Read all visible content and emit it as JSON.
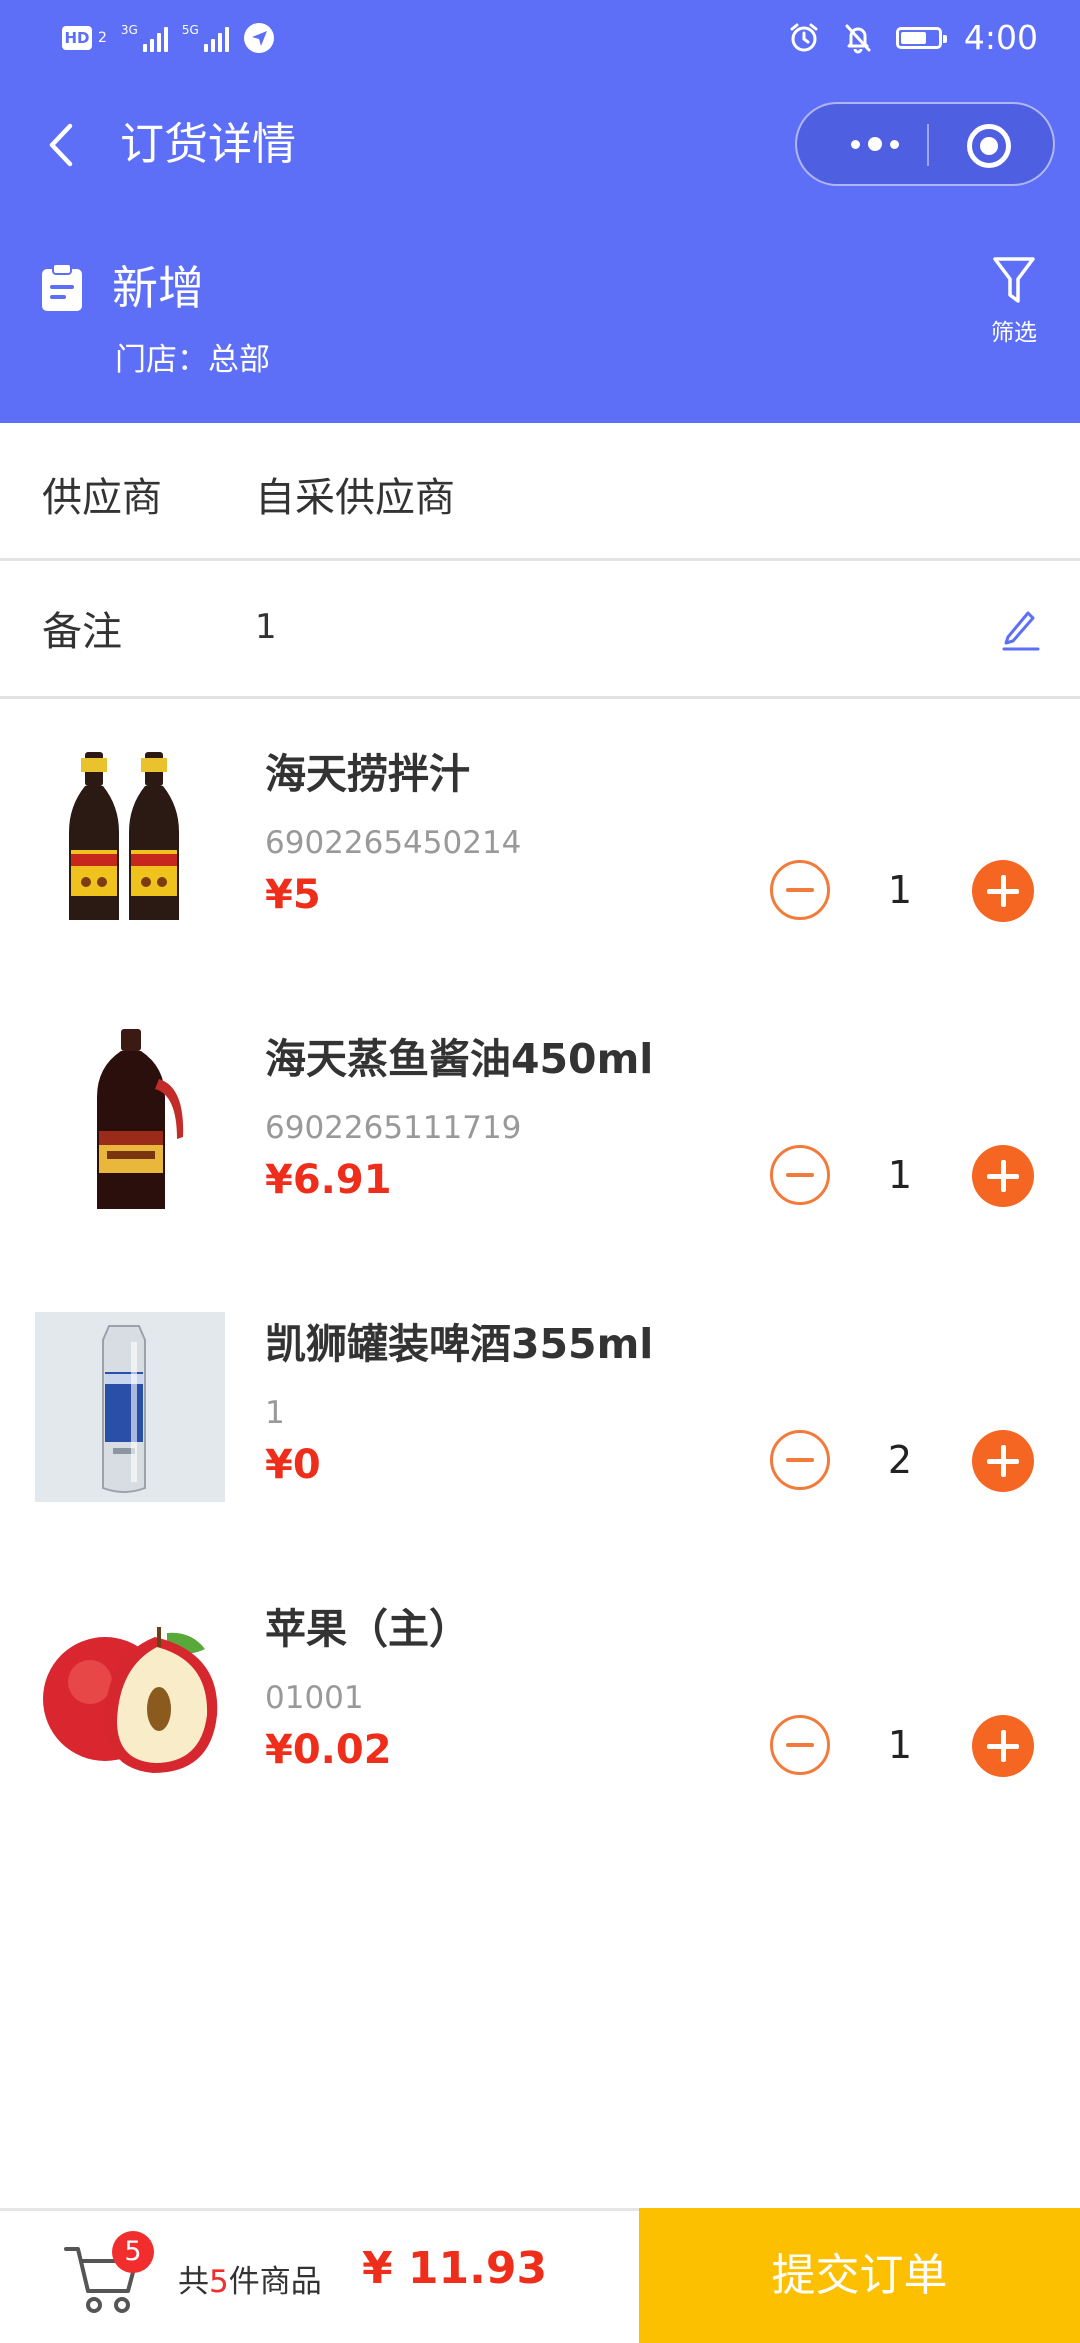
{
  "status_bar": {
    "time": "4:00",
    "network_1": "3G",
    "network_2": "5G",
    "hd_label": "HD",
    "hd_sub": "2",
    "battery_level": 0.7
  },
  "nav": {
    "title": "订货详情"
  },
  "order": {
    "status": "新增",
    "store": "门店：总部",
    "filter_label": "筛选"
  },
  "fields": {
    "supplier_label": "供应商",
    "supplier_value": "自采供应商",
    "note_label": "备注",
    "note_value": "1"
  },
  "items": [
    {
      "name": "海天捞拌汁",
      "code": "6902265450214",
      "price": "¥5",
      "qty": "1",
      "image": "soy-bottles"
    },
    {
      "name": "海天蒸鱼酱油450ml",
      "code": "6902265111719",
      "price": "¥6.91",
      "qty": "1",
      "image": "soy-sauce-bottle"
    },
    {
      "name": "凯狮罐装啤酒355ml",
      "code": "1",
      "price": "¥0",
      "qty": "2",
      "image": "beer-can"
    },
    {
      "name": "苹果（主）",
      "code": "01001",
      "price": "¥0.02",
      "qty": "1",
      "image": "apple"
    }
  ],
  "footer": {
    "badge": "5",
    "count_prefix": "共",
    "count_num": "5",
    "count_suffix": "件商品",
    "total": "¥ 11.93",
    "submit_label": "提交订单"
  },
  "colors": {
    "header_bg": "#5d6ef7",
    "price": "#ee2e1a",
    "plus": "#f56623",
    "submit_bg": "#fcc001"
  }
}
